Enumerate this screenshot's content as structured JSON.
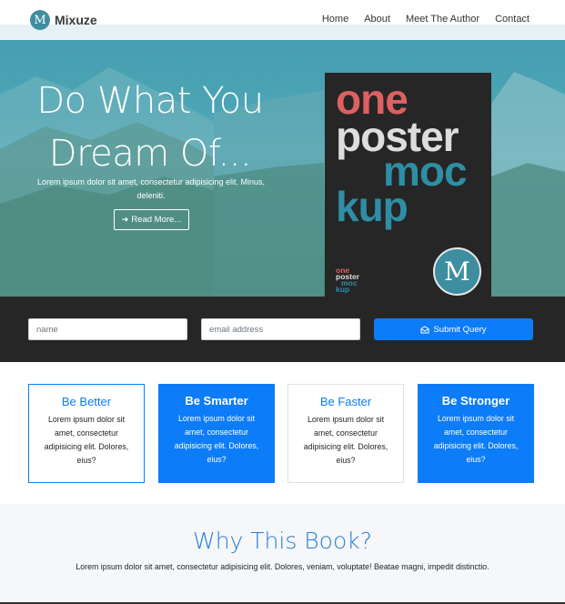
{
  "nav": {
    "brand_logo": "M",
    "brand_name": "Mixuze",
    "links": [
      "Home",
      "About",
      "Meet The Author",
      "Contact"
    ]
  },
  "hero": {
    "title_line1": "Do What You",
    "title_line2": "Dream Of...",
    "text": "Lorem ipsum dolor sit amet, consectetur adipisicing elit. Minus, deleniti.",
    "button_label": "Read More...",
    "button_icon": "arrow-right-icon"
  },
  "poster": {
    "line1": "one",
    "line2": "poster",
    "line3": "moc",
    "line4": "kup",
    "badge": "M",
    "colors": {
      "red": "#de6060",
      "light": "#dddddd",
      "teal": "#2e8ea5",
      "bg": "#262626"
    }
  },
  "signup": {
    "name_placeholder": "name",
    "email_placeholder": "email address",
    "submit_label": "Submit Query",
    "submit_icon": "envelope-icon"
  },
  "cards": [
    {
      "title": "Be Better",
      "text": "Lorem ipsum dolor sit amet, consectetur adipisicing elit. Dolores, eius?",
      "style": "outline"
    },
    {
      "title": "Be Smarter",
      "text": "Lorem ipsum dolor sit amet, consectetur adipisicing elit. Dolores, eius?",
      "style": "filled"
    },
    {
      "title": "Be Faster",
      "text": "Lorem ipsum dolor sit amet, consectetur adipisicing elit. Dolores, eius?",
      "style": "plain"
    },
    {
      "title": "Be Stronger",
      "text": "Lorem ipsum dolor sit amet, consectetur adipisicing elit. Dolores, eius?",
      "style": "filled"
    }
  ],
  "why": {
    "heading": "Why This Book?",
    "text": "Lorem ipsum dolor sit amet, consectetur adipisicing elit. Dolores, veniam, voluptate! Beatae magni, impedit distinctio."
  },
  "colors": {
    "primary": "#0d7cf8",
    "brand": "#3d8ea0",
    "dark": "#262626"
  }
}
